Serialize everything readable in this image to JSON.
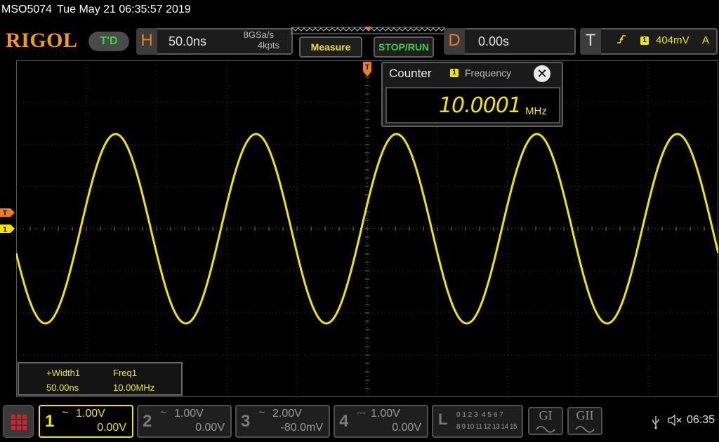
{
  "status": {
    "model": "MSO5074",
    "datetime": "Tue May 21 06:35:57 2019"
  },
  "header": {
    "brand": "RIGOL",
    "trigger_status": "T'D",
    "horizontal": {
      "letter": "H",
      "timebase": "50.0ns",
      "sample_rate": "8GSa/s",
      "memory_depth": "4kpts"
    },
    "measure_button": "Measure",
    "stop_run_button": "STOP/RUN",
    "delay": {
      "letter": "D",
      "value": "0.00s"
    },
    "trigger": {
      "letter": "T",
      "source_badge": "1",
      "level": "404mV",
      "mode": "A"
    }
  },
  "markers": {
    "trigger_top": "T",
    "trigger_level": "T",
    "channel1": "1"
  },
  "counter": {
    "title": "Counter",
    "source_badge": "1",
    "mode": "Frequency",
    "value": "10.0001",
    "unit": "MHz",
    "close_glyph": "✕"
  },
  "measurements": {
    "items": [
      {
        "label": "+Width1",
        "value": "50.00ns"
      },
      {
        "label": "Freq1",
        "value": "10.00MHz"
      }
    ]
  },
  "waveform": {
    "color": "#f2e300",
    "frequency_mhz": 10.0001,
    "timebase_ns_per_div": 50,
    "volts_per_div": 1.0,
    "amplitude_v": 2.25,
    "offset_v": 0.0,
    "phase_deg": 195
  },
  "grid": {
    "h_divs": 10,
    "v_divs": 8,
    "color": "#3a3a3a"
  },
  "channels": [
    {
      "num": "1",
      "coupling": "~",
      "scale": "1.00V",
      "offset": "0.00V",
      "active": true,
      "color": "#f2e300"
    },
    {
      "num": "2",
      "coupling": "~",
      "scale": "1.00V",
      "offset": "0.00V",
      "active": false,
      "color": "#7a7a7a"
    },
    {
      "num": "3",
      "coupling": "~",
      "scale": "2.00V",
      "offset": "-80.0mV",
      "active": false,
      "color": "#7a7a7a"
    },
    {
      "num": "4",
      "coupling": "⎓",
      "scale": "1.00V",
      "offset": "0.00V",
      "active": false,
      "color": "#7a7a7a"
    }
  ],
  "logic": {
    "letter": "L",
    "row1": "0 1 2 3  4 5 6 7",
    "row2": "8 9 10 11 12 13 14 15"
  },
  "generators": [
    {
      "label": "GI"
    },
    {
      "label": "GII"
    }
  ],
  "system": {
    "usb_icon": "usb-icon",
    "speaker_icon": "speaker-muted-icon",
    "time": "06:35"
  }
}
